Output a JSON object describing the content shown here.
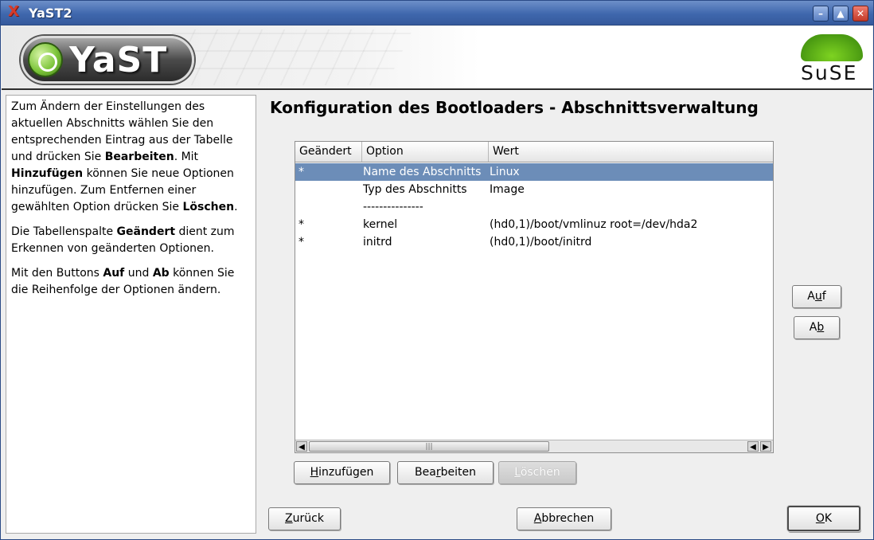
{
  "window": {
    "title": "YaST2",
    "buttons": {
      "minimize": "–",
      "maximize": "▲",
      "close": "✕"
    }
  },
  "banner": {
    "yast_logo_text": "YaST",
    "suse_logo_text": "SuSE"
  },
  "help": {
    "p1": [
      {
        "t": "Zum Ändern der Einstellungen des aktuellen Abschnitts wählen Sie den entsprechenden Eintrag aus der Tabelle und drücken Sie ",
        "b": false
      },
      {
        "t": "Bearbeiten",
        "b": true
      },
      {
        "t": ". Mit ",
        "b": false
      },
      {
        "t": "Hinzufügen",
        "b": true
      },
      {
        "t": " können Sie neue Optionen hinzufügen. Zum Entfernen einer gewählten Option drücken Sie ",
        "b": false
      },
      {
        "t": "Löschen",
        "b": true
      },
      {
        "t": ".",
        "b": false
      }
    ],
    "p2": [
      {
        "t": "Die Tabellenspalte ",
        "b": false
      },
      {
        "t": "Geändert",
        "b": true
      },
      {
        "t": " dient zum Erkennen von geänderten Optionen.",
        "b": false
      }
    ],
    "p3": [
      {
        "t": "Mit den Buttons ",
        "b": false
      },
      {
        "t": "Auf",
        "b": true
      },
      {
        "t": " und ",
        "b": false
      },
      {
        "t": "Ab",
        "b": true
      },
      {
        "t": " können Sie die Reihenfolge der Optionen ändern.",
        "b": false
      }
    ]
  },
  "main": {
    "heading": "Konfiguration des Bootloaders - Abschnittsverwaltung",
    "table": {
      "columns": [
        "Geändert",
        "Option",
        "Wert"
      ],
      "rows": [
        [
          "*",
          "Name des Abschnitts",
          "Linux"
        ],
        [
          "",
          "Typ des Abschnitts",
          "Image"
        ],
        [
          "",
          "---------------",
          ""
        ],
        [
          "*",
          "kernel",
          "(hd0,1)/boot/vmlinuz root=/dev/hda2"
        ],
        [
          "*",
          "initrd",
          "(hd0,1)/boot/initrd"
        ]
      ],
      "selected_row": 0
    },
    "buttons": {
      "add": {
        "pre": "",
        "u": "H",
        "post": "inzufügen"
      },
      "edit": {
        "pre": "Bea",
        "u": "r",
        "post": "beiten"
      },
      "delete": {
        "pre": "",
        "u": "L",
        "post": "öschen"
      },
      "up": {
        "pre": "A",
        "u": "u",
        "post": "f"
      },
      "down": {
        "pre": "A",
        "u": "b",
        "post": ""
      }
    }
  },
  "footer": {
    "back": {
      "pre": "",
      "u": "Z",
      "post": "urück"
    },
    "abort": {
      "pre": "",
      "u": "A",
      "post": "bbrechen"
    },
    "ok": {
      "pre": "",
      "u": "O",
      "post": "K"
    }
  }
}
